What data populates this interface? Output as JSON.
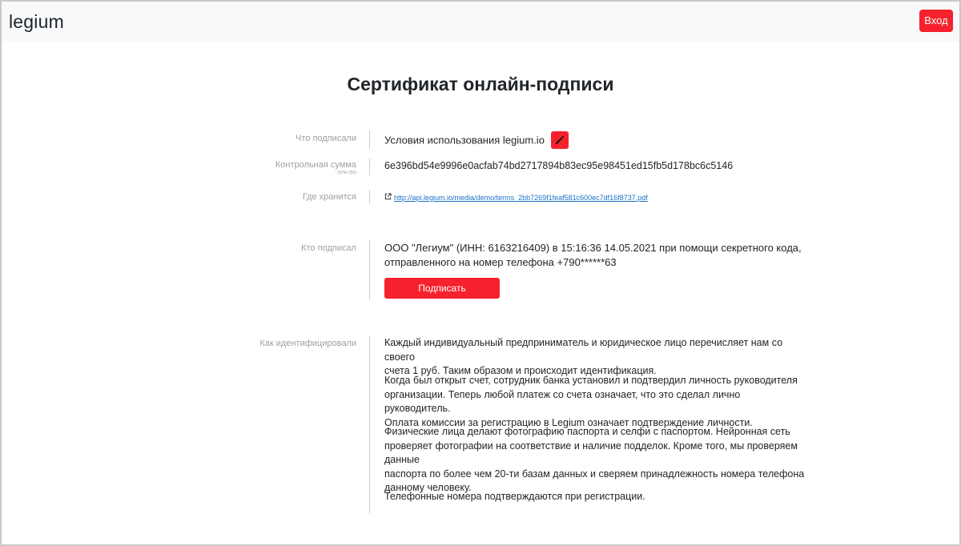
{
  "header": {
    "brand": "legium",
    "login_label": "Вход"
  },
  "page": {
    "title": "Сертификат онлайн-подписи"
  },
  "fields": {
    "what_signed": {
      "label": "Что подписали",
      "value": "Условия использования legium.io",
      "edit_icon": "pencil-icon"
    },
    "checksum": {
      "label": "Контрольная сумма",
      "sublabel": "(SHA-256)",
      "value": "6e396bd54e9996e0acfab74bd2717894b83ec95e98451ed15fb5d178bc6c5146"
    },
    "storage": {
      "label": "Где хранится",
      "url": "http://api.legium.io/media/demo/terms_2bb7269f1feaf581c600ec7df16f8737.pdf",
      "icon": "external-link-icon"
    },
    "who_signed": {
      "label": "Кто подписал",
      "line1": "ООО \"Легиум\" (ИНН: 6163216409) в 15:16:36 14.05.2021 при помощи секретного кода,",
      "line2": "отправленного на номер телефона +790******63",
      "sign_button": "Подписать"
    },
    "identification": {
      "label": "Как идентифицировали",
      "paragraphs": [
        {
          "lines": [
            "Каждый индивидуальный предприниматель и юридическое лицо перечисляет нам со своего",
            "счета 1 руб. Таким образом и происходит идентификация."
          ]
        },
        {
          "lines": [
            "Когда был открыт счет, сотрудник банка установил и подтвердил личность руководителя",
            "организации. Теперь любой платеж со счета означает, что это сделал лично руководитель.",
            "Оплата комиссии за регистрацию в Legium означает подтверждение личности."
          ]
        },
        {
          "lines": [
            "Физические лица делают фотографию паспорта и селфи с паспортом. Нейронная сеть",
            "проверяет фотографии на соответствие и наличие подделок. Кроме того, мы проверяем данные",
            "паспорта по более чем 20-ти базам данных и сверяем принадлежность номера телефона",
            "данному человеку."
          ]
        },
        {
          "lines": [
            "Телефонные номера подтверждаются при регистрации."
          ]
        }
      ]
    }
  },
  "colors": {
    "accent": "#f5222d",
    "link": "#1a73c8",
    "label": "#9aa0a6"
  }
}
